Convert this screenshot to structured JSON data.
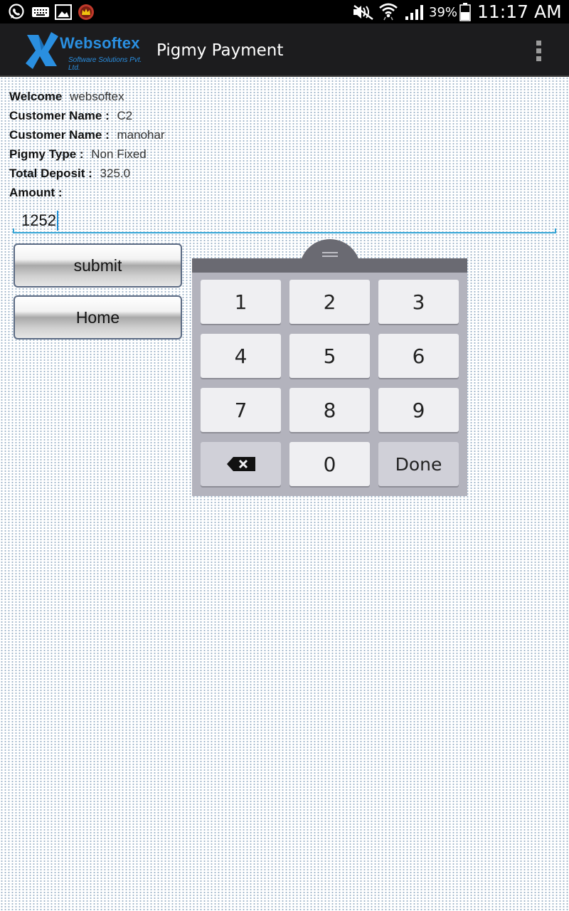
{
  "status_bar": {
    "battery": "39%",
    "time": "11:17 AM",
    "left_icons": [
      "whatsapp-icon",
      "keyboard-icon",
      "gallery-icon",
      "crown-app-icon"
    ],
    "right_icons": [
      "mute-icon",
      "wifi-icon",
      "signal-icon",
      "battery-icon"
    ]
  },
  "action_bar": {
    "brand_name": "Websoftex",
    "brand_tagline": "Software Solutions Pvt. Ltd.",
    "title": "Pigmy Payment",
    "brand_color": "#2a8fe0"
  },
  "form": {
    "welcome_label": "Welcome",
    "welcome_value": "websoftex",
    "customer_name_label_1": "Customer Name :",
    "customer_name_value_1": "C2",
    "customer_name_label_2": "Customer Name :",
    "customer_name_value_2": "manohar",
    "pigmy_type_label": "Pigmy Type :",
    "pigmy_type_value": "Non Fixed",
    "total_deposit_label": "Total Deposit :",
    "total_deposit_value": "325.0",
    "amount_label": "Amount :",
    "amount_value": "1252",
    "submit_label": "submit",
    "home_label": "Home",
    "accent_color": "#33a5d6"
  },
  "keypad": {
    "keys": [
      "1",
      "2",
      "3",
      "4",
      "5",
      "6",
      "7",
      "8",
      "9",
      "0"
    ],
    "done_label": "Done",
    "backspace_icon": "backspace-icon"
  }
}
